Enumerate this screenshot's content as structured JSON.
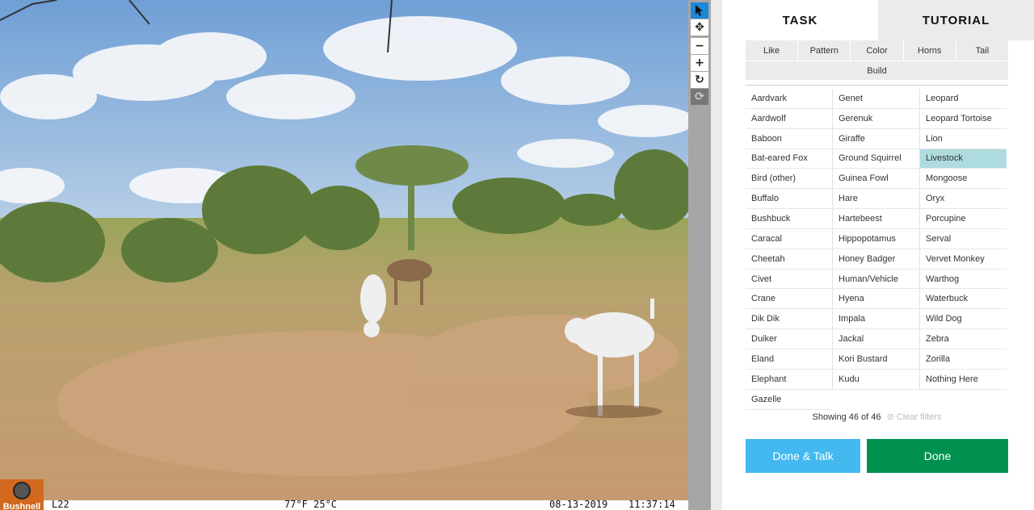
{
  "camera_strip": {
    "brand": "Bushnell",
    "moon_label": "L22",
    "temperature": "77°F 25°C",
    "date": "08-13-2019",
    "time": "11:37:14"
  },
  "toolbar": {
    "icons": [
      "pointer-icon",
      "move-icon",
      "zoom-out-icon",
      "zoom-in-icon",
      "rotate-icon",
      "reset-icon"
    ]
  },
  "tabs": {
    "task": "TASK",
    "tutorial": "TUTORIAL"
  },
  "filters": {
    "row1": [
      "Like",
      "Pattern",
      "Color",
      "Horns",
      "Tail"
    ],
    "row2": "Build"
  },
  "species": {
    "col0": [
      "Aardvark",
      "Aardwolf",
      "Baboon",
      "Bat-eared Fox",
      "Bird (other)",
      "Buffalo",
      "Bushbuck",
      "Caracal",
      "Cheetah",
      "Civet",
      "Crane",
      "Dik Dik",
      "Duiker",
      "Eland",
      "Elephant",
      "Gazelle"
    ],
    "col1": [
      "Genet",
      "Gerenuk",
      "Giraffe",
      "Ground Squirrel",
      "Guinea Fowl",
      "Hare",
      "Hartebeest",
      "Hippopotamus",
      "Honey Badger",
      "Human/Vehicle",
      "Hyena",
      "Impala",
      "Jackal",
      "Kori Bustard",
      "Kudu"
    ],
    "col2": [
      "Leopard",
      "Leopard Tortoise",
      "Lion",
      "Livestock",
      "Mongoose",
      "Oryx",
      "Porcupine",
      "Serval",
      "Vervet Monkey",
      "Warthog",
      "Waterbuck",
      "Wild Dog",
      "Zebra",
      "Zorilla",
      "Nothing Here"
    ],
    "selected": "Livestock"
  },
  "status": {
    "showing": "Showing 46 of 46",
    "clear_filters": "Clear filters"
  },
  "buttons": {
    "done_talk": "Done & Talk",
    "done": "Done"
  },
  "colors": {
    "selected": "#aedcde",
    "done_talk": "#43b9f0",
    "done": "#00914f",
    "tool_active": "#1e88d8"
  }
}
